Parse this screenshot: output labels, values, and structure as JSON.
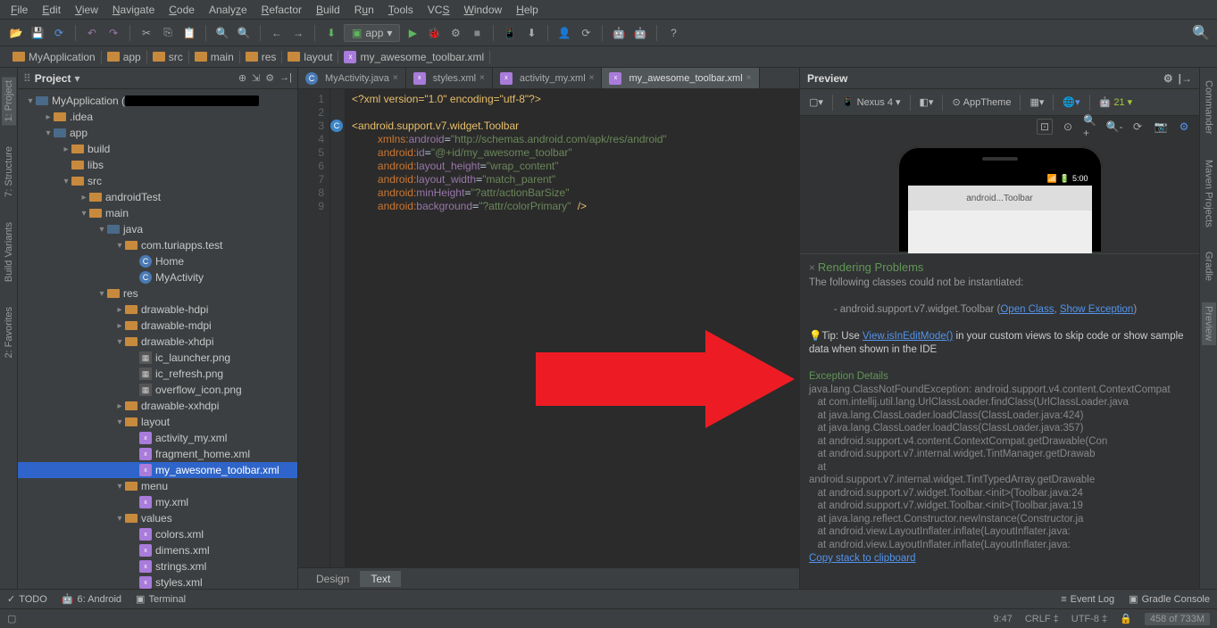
{
  "menu": [
    "File",
    "Edit",
    "View",
    "Navigate",
    "Code",
    "Analyze",
    "Refactor",
    "Build",
    "Run",
    "Tools",
    "VCS",
    "Window",
    "Help"
  ],
  "app_selector": "app",
  "breadcrumbs": [
    "MyApplication",
    "app",
    "src",
    "main",
    "res",
    "layout",
    "my_awesome_toolbar.xml"
  ],
  "project": {
    "title": "Project",
    "root": "MyApplication (",
    "tree": {
      "idea": ".idea",
      "app": "app",
      "build": "build",
      "libs": "libs",
      "src": "src",
      "androidTest": "androidTest",
      "main": "main",
      "java_folder": "java",
      "package": "com.turiapps.test",
      "home": "Home",
      "myactivity": "MyActivity",
      "res": "res",
      "drawable_hdpi": "drawable-hdpi",
      "drawable_mdpi": "drawable-mdpi",
      "drawable_xhdpi": "drawable-xhdpi",
      "ic_launcher": "ic_launcher.png",
      "ic_refresh": "ic_refresh.png",
      "overflow_icon": "overflow_icon.png",
      "drawable_xxhdpi": "drawable-xxhdpi",
      "layout": "layout",
      "activity_my": "activity_my.xml",
      "fragment_home": "fragment_home.xml",
      "my_awesome_toolbar": "my_awesome_toolbar.xml",
      "menu": "menu",
      "my_xml": "my.xml",
      "values": "values",
      "colors": "colors.xml",
      "dimens": "dimens.xml",
      "strings": "strings.xml",
      "styles": "styles.xml"
    }
  },
  "tabs": [
    {
      "label": "MyActivity.java",
      "icon": "C"
    },
    {
      "label": "styles.xml",
      "icon": "x"
    },
    {
      "label": "activity_my.xml",
      "icon": "x"
    },
    {
      "label": "my_awesome_toolbar.xml",
      "icon": "x",
      "active": true
    }
  ],
  "code_lines": [
    "1",
    "2",
    "3",
    "4",
    "5",
    "6",
    "7",
    "8",
    "9"
  ],
  "xml": {
    "decl": "<?xml version=\"1.0\" encoding=\"utf-8\"?>",
    "open_tag": "<android.support.v7.widget.Toolbar",
    "xmlns": "xmlns:android=\"http://schemas.android.com/apk/res/android\"",
    "id": "android:id=\"@+id/my_awesome_toolbar\"",
    "height": "android:layout_height=\"wrap_content\"",
    "width": "android:layout_width=\"match_parent\"",
    "minHeight": "android:minHeight=\"?attr/actionBarSize\"",
    "background": "android:background=\"?attr/colorPrimary\" />"
  },
  "design_tab": "Design",
  "text_tab": "Text",
  "preview": {
    "title": "Preview",
    "device": "Nexus 4",
    "theme": "AppTheme",
    "api": "21",
    "status_time": "5:00",
    "toolbar_text": "android...Toolbar"
  },
  "render": {
    "title": "Rendering Problems",
    "subtitle": "The following classes could not be instantiated:",
    "item": "- android.support.v7.widget.Toolbar (",
    "open_class": "Open Class",
    "comma": ", ",
    "show_exception": "Show Exception",
    "close_paren": ")",
    "tip_pre": "Tip: Use ",
    "tip_link": "View.isInEditMode()",
    "tip_post": " in your custom views to skip code or show sample data when shown in the IDE",
    "exc_title": "Exception Details",
    "trace": "java.lang.ClassNotFoundException: android.support.v4.content.ContextCompat\n   at com.intellij.util.lang.UrlClassLoader.findClass(UrlClassLoader.java\n   at java.lang.ClassLoader.loadClass(ClassLoader.java:424)\n   at java.lang.ClassLoader.loadClass(ClassLoader.java:357)\n   at android.support.v4.content.ContextCompat.getDrawable(Con\n   at android.support.v7.internal.widget.TintManager.getDrawab\n   at \nandroid.support.v7.internal.widget.TintTypedArray.getDrawable\n   at android.support.v7.widget.Toolbar.<init>(Toolbar.java:24\n   at android.support.v7.widget.Toolbar.<init>(Toolbar.java:19\n   at java.lang.reflect.Constructor.newInstance(Constructor.ja\n   at android.view.LayoutInflater.inflate(LayoutInflater.java:\n   at android.view.LayoutInflater.inflate(LayoutInflater.java:",
    "copy": "Copy stack to clipboard"
  },
  "left_tabs": {
    "project": "1: Project",
    "structure": "7: Structure",
    "favorites": "2: Favorites",
    "build_variants": "Build Variants"
  },
  "right_tabs": {
    "commander": "Commander",
    "maven": "Maven Projects",
    "gradle": "Gradle",
    "preview": "Preview"
  },
  "bottom": {
    "todo": "TODO",
    "android": "6: Android",
    "terminal": "Terminal",
    "event_log": "Event Log",
    "gradle_console": "Gradle Console"
  },
  "status": {
    "pos": "9:47",
    "crlf": "CRLF",
    "enc": "UTF-8",
    "lock": "🔒",
    "mem": "458 of 733M"
  }
}
